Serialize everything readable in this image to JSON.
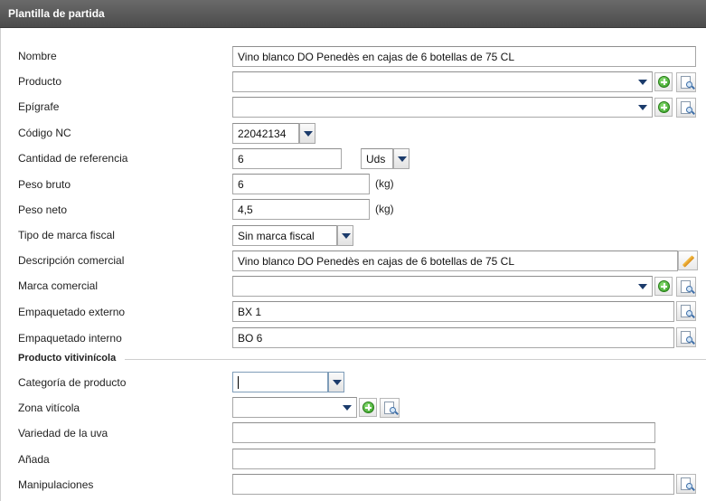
{
  "window": {
    "title": "Plantilla de partida"
  },
  "form": {
    "nombre": {
      "label": "Nombre",
      "value": "Vino blanco DO Penedès en cajas de 6 botellas de 75 CL"
    },
    "producto": {
      "label": "Producto",
      "value": ""
    },
    "epigrafe": {
      "label": "Epígrafe",
      "value": ""
    },
    "codigo_nc": {
      "label": "Código NC",
      "value": "22042134"
    },
    "cantidad_referencia": {
      "label": "Cantidad de referencia",
      "value": "6",
      "unit_selected": "Uds"
    },
    "peso_bruto": {
      "label": "Peso bruto",
      "value": "6",
      "unit": "(kg)"
    },
    "peso_neto": {
      "label": "Peso neto",
      "value": "4,5",
      "unit": "(kg)"
    },
    "tipo_marca_fiscal": {
      "label": "Tipo de marca fiscal",
      "value": "Sin marca fiscal"
    },
    "descripcion_comercial": {
      "label": "Descripción comercial",
      "value": "Vino blanco DO Penedès en cajas de 6 botellas de 75 CL"
    },
    "marca_comercial": {
      "label": "Marca comercial",
      "value": ""
    },
    "empaquetado_externo": {
      "label": "Empaquetado externo",
      "value": "BX 1"
    },
    "empaquetado_interno": {
      "label": "Empaquetado interno",
      "value": "BO 6"
    }
  },
  "vitivinicola": {
    "section_title": "Producto vitivinícola",
    "categoria_producto": {
      "label": "Categoría de producto",
      "value": ""
    },
    "zona_viticola": {
      "label": "Zona vitícola",
      "value": ""
    },
    "variedad_uva": {
      "label": "Variedad de la uva",
      "value": ""
    },
    "anada": {
      "label": "Añada",
      "value": ""
    },
    "manipulaciones": {
      "label": "Manipulaciones",
      "value": ""
    }
  },
  "icons": {
    "dropdown": "chevron-down-icon",
    "add": "add-circle-icon",
    "lookup": "search-document-icon",
    "edit": "pencil-icon"
  },
  "colors": {
    "title_bar": "#555555",
    "dropdown_arrow": "#1b3b6b",
    "add_green": "#2f9b1d"
  }
}
